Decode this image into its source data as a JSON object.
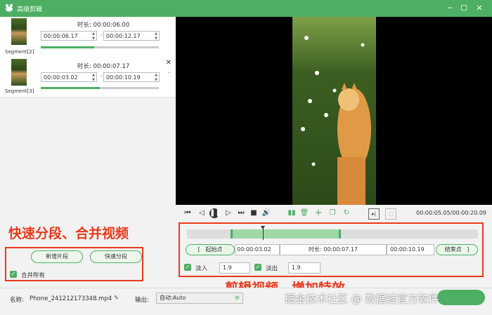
{
  "window": {
    "title": "高级剪辑",
    "controls": [
      "─",
      "☐",
      "✕"
    ]
  },
  "segments": [
    {
      "caption": "Segment[2]",
      "duration_label": "时长:",
      "duration": "00:00:06.00",
      "start": "00:00:06.17",
      "end": "00:00:12.17",
      "progress": 0.45
    },
    {
      "caption": "Segment[3]",
      "duration_label": "时长:",
      "duration": "00:00:07.17",
      "start": "00:00:03.02",
      "end": "00:00:10.19",
      "progress": 0.5
    }
  ],
  "left_buttons": {
    "add_segment": "新增片段",
    "quick_split": "快速分段",
    "merge_all": "合并所有"
  },
  "annotations": {
    "left": "快速分段、合并视频",
    "right": "剪辑视频，增加特效"
  },
  "player": {
    "timecode": "00:00:05.05/00:00:20.09",
    "playhead": 0.15
  },
  "trim": {
    "start_label": "起始点",
    "start_bracket": "[",
    "start_value": "00:00:03.02",
    "duration_label": "时长:",
    "duration_value": "00:00:07.17",
    "end_value": "00:00:10.19",
    "end_label": "结束点",
    "end_bracket": "]",
    "selection_start": 0.15,
    "selection_end": 0.53
  },
  "effects": {
    "fade_in_label": "淡入",
    "fade_in_value": "1.9",
    "fade_out_label": "淡出",
    "fade_out_value": "1.9"
  },
  "bottom": {
    "name_label": "名称:",
    "name_value": "Phone_241212173348.mp4",
    "output_label": "输出:",
    "output_value": "自动;Auto"
  },
  "watermark": "掘金技术社区 @ 数据蛙官方软件",
  "colors": {
    "accent": "#4caf63",
    "annotation": "#e8391d"
  }
}
